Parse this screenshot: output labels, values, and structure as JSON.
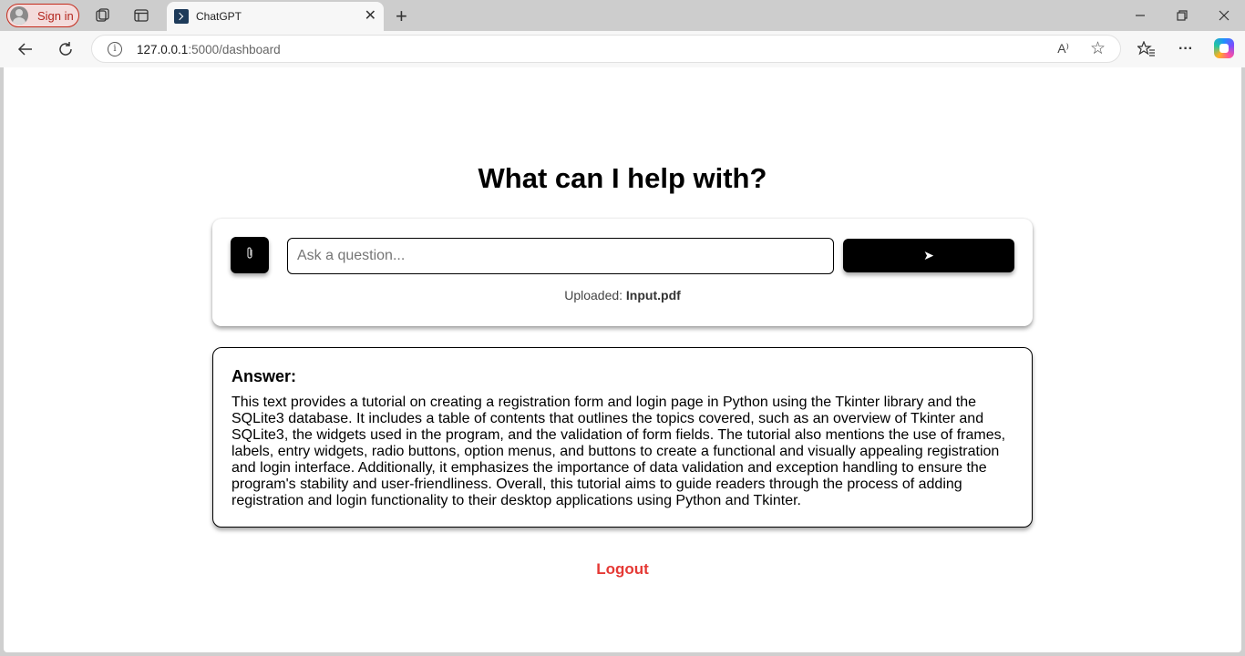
{
  "browser": {
    "signin_label": "Sign in",
    "tab": {
      "title": "ChatGPT",
      "close_glyph": "✕"
    },
    "new_tab_glyph": "+",
    "address": {
      "host": "127.0.0.1",
      "path": ":5000/dashboard"
    },
    "read_aloud_glyph": "A⁾",
    "favorite_glyph": "☆",
    "more_glyph": "···"
  },
  "page": {
    "headline": "What can I help with?",
    "ask": {
      "attach_glyph": "📎",
      "input_placeholder": "Ask a question...",
      "input_value": "",
      "send_glyph": "➤",
      "uploaded_label": "Uploaded:",
      "uploaded_filename": "Input.pdf"
    },
    "answer": {
      "title": "Answer:",
      "text": "This text provides a tutorial on creating a registration form and login page in Python using the Tkinter library and the SQLite3 database. It includes a table of contents that outlines the topics covered, such as an overview of Tkinter and SQLite3, the widgets used in the program, and the validation of form fields. The tutorial also mentions the use of frames, labels, entry widgets, radio buttons, option menus, and buttons to create a functional and visually appealing registration and login interface. Additionally, it emphasizes the importance of data validation and exception handling to ensure the program's stability and user-friendliness. Overall, this tutorial aims to guide readers through the process of adding registration and login functionality to their desktop applications using Python and Tkinter."
    },
    "logout_label": "Logout"
  },
  "colors": {
    "logout": "#e53935",
    "button_bg": "#000000",
    "signin_border": "#c42b1c"
  }
}
